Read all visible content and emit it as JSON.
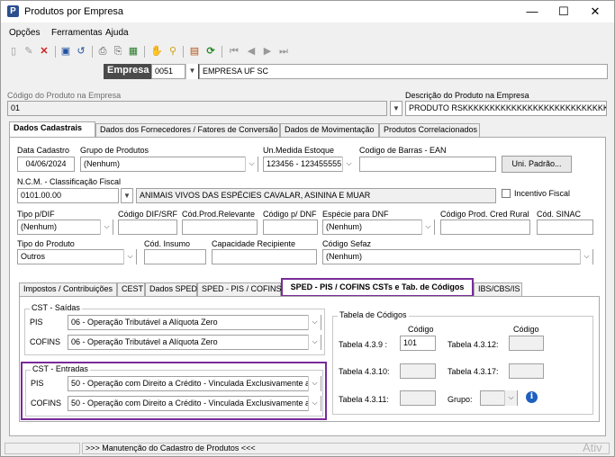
{
  "window": {
    "title": "Produtos por Empresa",
    "minimize": "—",
    "maximize": "☐",
    "close": "✕"
  },
  "menu": [
    "Opções",
    "Ferramentas",
    "Ajuda"
  ],
  "empresa": {
    "label": "Empresa",
    "code": "0051",
    "name": "EMPRESA UF SC"
  },
  "produto": {
    "codigo_label": "Código do Produto na Empresa",
    "codigo_value": "01",
    "descricao_label": "Descrição do Produto na Empresa",
    "descricao_value": "PRODUTO RSKKKKKKKKKKKKKKKKKKKKKKKKKKKKKKKKKK"
  },
  "main_tabs": [
    "Dados Cadastrais",
    "Dados dos Fornecedores / Fatores de Conversão",
    "Dados de Movimentação",
    "Produtos Correlacionados"
  ],
  "cadastro": {
    "data_label": "Data Cadastro",
    "data_value": "04/06/2024",
    "grupo_label": "Grupo de Produtos",
    "grupo_value": "(Nenhum)",
    "unmed_label": "Un.Medida Estoque",
    "unmed_value": "123456 - 123455555",
    "barras_label": "Codigo de Barras - EAN",
    "barras_value": "",
    "uni_padrao": "Uni. Padrão...",
    "ncm_label": "N.C.M. - Classificação Fiscal",
    "ncm_value": "0101.00.00",
    "ncm_desc": "ANIMAIS VIVOS DAS ESPÉCIES CAVALAR, ASININA E MUAR",
    "incentivo_label": "Incentivo Fiscal",
    "tipodif_label": "Tipo p/DIF",
    "tipodif_value": "(Nenhum)",
    "coddif_label": "Código DIF/SRF",
    "codprod_label": "Cód.Prod.Relevante",
    "coddnf_label": "Código p/ DNF",
    "especie_label": "Espécie para DNF",
    "especie_value": "(Nenhum)",
    "credrural_label": "Código Prod. Cred Rural",
    "sinac_label": "Cód. SINAC",
    "tipoprod_label": "Tipo do Produto",
    "tipoprod_value": "Outros",
    "insumo_label": "Cód. Insumo",
    "capac_label": "Capacidade Recipiente",
    "sefaz_label": "Código Sefaz",
    "sefaz_value": "(Nenhum)"
  },
  "sub_tabs": [
    "Impostos / Contribuições",
    "CEST",
    "Dados SPED",
    "SPED - PIS / COFINS",
    "SPED - PIS / COFINS CSTs e Tab. de Códigos",
    "IBS/CBS/IS"
  ],
  "cst_saidas": {
    "title": "CST - Saídas",
    "pis_label": "PIS",
    "pis_value": "06 - Operação Tributável a Alíquota Zero",
    "cofins_label": "COFINS",
    "cofins_value": "06 - Operação Tributável a Alíquota Zero"
  },
  "cst_entradas": {
    "title": "CST - Entradas",
    "pis_label": "PIS",
    "pis_value": "50 - Operação com Direito a Crédito - Vinculada Exclusivamente a",
    "cofins_label": "COFINS",
    "cofins_value": "50 - Operação com Direito a Crédito - Vinculada Exclusivamente a"
  },
  "tabela": {
    "title": "Tabela de Códigos",
    "codigo_header": "Código",
    "t439_label": "Tabela 4.3.9 :",
    "t439_value": "101",
    "t4312_label": "Tabela 4.3.12:",
    "t4310_label": "Tabela 4.3.10:",
    "t4317_label": "Tabela 4.3.17:",
    "t4311_label": "Tabela 4.3.11:",
    "grupo_label": "Grupo:"
  },
  "status": {
    "message": ">>> Manutenção do Cadastro de Produtos <<<",
    "watermark": "Ativ"
  },
  "colors": {
    "highlight": "#7a2b9a",
    "empresa_bar": "#4a4a4a",
    "info_icon": "#1f5fbf"
  }
}
